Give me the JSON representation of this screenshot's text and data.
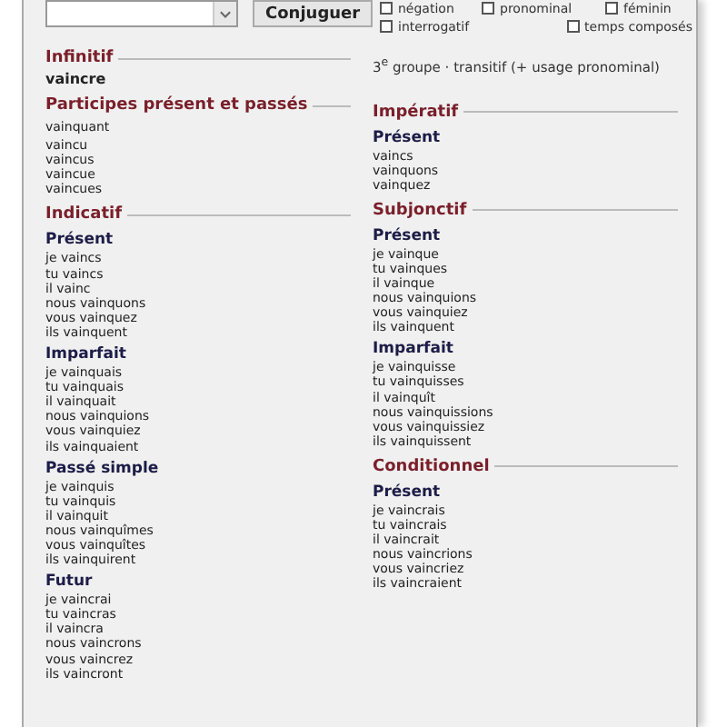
{
  "conjugate_button": "Conjuguer",
  "options": [
    {
      "label": "négation",
      "checked": false
    },
    {
      "label": "pronominal",
      "checked": false
    },
    {
      "label": "féminin",
      "checked": false
    },
    {
      "label": "interrogatif",
      "checked": false
    },
    {
      "label": "temps composés",
      "checked": false
    }
  ],
  "infinitive": {
    "title": "Infinitif",
    "verb": "vaincre"
  },
  "info": "3$^{e}$ groupe · transitif (+ usage pronominal)",
  "left_sections": [
    {
      "title": "Participes présent et passés",
      "groups": [
        {
          "lines": [
            "vainquant"
          ]
        },
        {
          "lines": [
            "vaincu",
            "vaincus",
            "vaincue",
            "vaincues"
          ]
        }
      ]
    },
    {
      "title": "Indicatif",
      "groups": [
        {
          "heading": "Présent",
          "lines": [
            "je vaincs",
            "tu vaincs",
            "il vainc",
            "nous vainquons",
            "vous vainquez",
            "ils vainquent"
          ]
        },
        {
          "heading": "Imparfait",
          "lines": [
            "je vainquais",
            "tu vainquais",
            "il vainquait",
            "nous vainquions",
            "vous vainquiez",
            "ils vainquaient"
          ]
        },
        {
          "heading": "Passé simple",
          "lines": [
            "je vainquis",
            "tu vainquis",
            "il vainquit",
            "nous vainquîmes",
            "vous vainquîtes",
            "ils vainquirent"
          ]
        },
        {
          "heading": "Futur",
          "lines": [
            "je vaincrai",
            "tu vaincras",
            "il vaincra",
            "nous vaincrons",
            "vous vaincrez",
            "ils vaincront"
          ]
        }
      ]
    }
  ],
  "right_sections": [
    {
      "title": "Impératif",
      "groups": [
        {
          "heading": "Présent",
          "lines": [
            "vaincs",
            "vainquons",
            "vainquez"
          ]
        }
      ]
    },
    {
      "title": "Subjonctif",
      "groups": [
        {
          "heading": "Présent",
          "lines": [
            "je vainque",
            "tu vainques",
            "il vainque",
            "nous vainquions",
            "vous vainquiez",
            "ils vainquent"
          ]
        },
        {
          "heading": "Imparfait",
          "lines": [
            "je vainquisse",
            "tu vainquisses",
            "il vainquît",
            "nous vainquissions",
            "vous vainquissiez",
            "ils vainquissent"
          ]
        }
      ]
    },
    {
      "title": "Conditionnel",
      "groups": [
        {
          "heading": "Présent",
          "lines": [
            "je vaincrais",
            "tu vaincrais",
            "il vaincrait",
            "nous vaincrions",
            "vous vaincriez",
            "ils vaincraient"
          ]
        }
      ]
    }
  ]
}
